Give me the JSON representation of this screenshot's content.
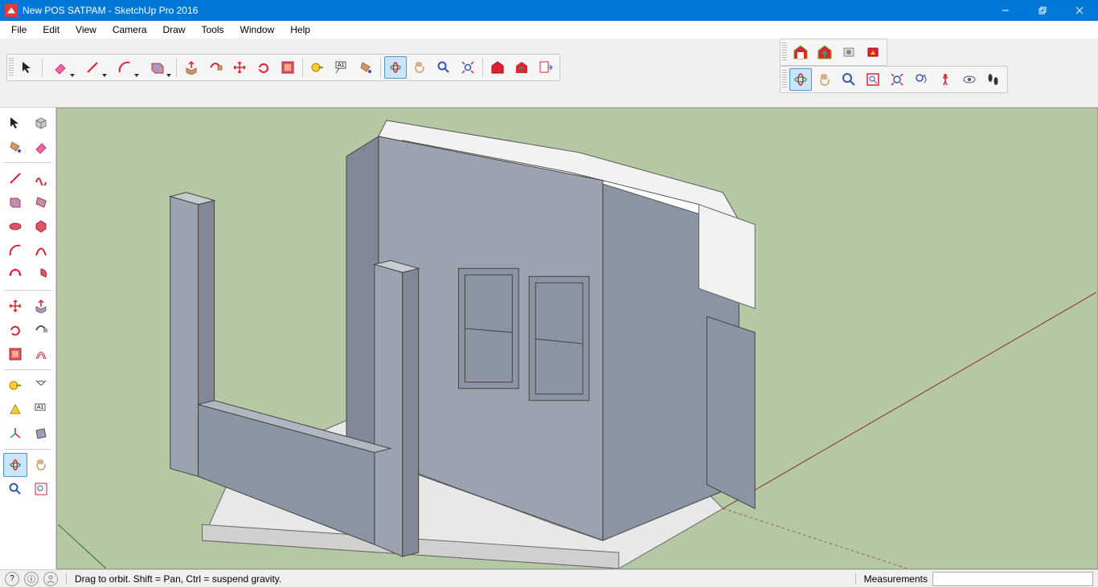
{
  "colors": {
    "accent": "#0078d7",
    "viewportGround": "#b3c8a3",
    "modelShade": "#8a94a2",
    "modelLight": "#e8e8e8"
  },
  "titlebar": {
    "title": "New POS SATPAM - SketchUp Pro 2016",
    "minimize": "Minimize",
    "maximize": "Restore Down",
    "close": "Close"
  },
  "menu": {
    "items": [
      "File",
      "Edit",
      "View",
      "Camera",
      "Draw",
      "Tools",
      "Window",
      "Help"
    ]
  },
  "topFloatA": {
    "warehouse": "3D Warehouse",
    "share": "Share Model",
    "ext1": "Extension Warehouse",
    "ext2": "Extension Manager"
  },
  "topFloatB": {
    "orbit": "Orbit",
    "pan": "Pan",
    "zoom": "Zoom",
    "zoomwin": "Zoom Window",
    "zoomext": "Zoom Extents",
    "prev": "Previous",
    "position": "Position Camera",
    "look": "Look Around",
    "walk": "Walk"
  },
  "mainToolbar": {
    "select": "Select",
    "eraser": "Eraser",
    "line": "Line",
    "arc": "Arc",
    "rect": "Rectangle",
    "pushpull": "Push/Pull",
    "followme": "Follow Me",
    "move": "Move",
    "rotate": "Rotate",
    "scale": "Offset",
    "paint": "Paint Bucket",
    "text": "Text",
    "dim": "Dimension",
    "tape": "Tape Measure",
    "orbit2": "Orbit",
    "pan2": "Pan",
    "zoom2": "Zoom",
    "zoomext2": "Zoom Extents",
    "wh": "Get Models",
    "share2": "Share Component",
    "layout": "Send to LayOut"
  },
  "largeToolset": {
    "select": "Select",
    "component": "Make Component",
    "paint": "Paint Bucket",
    "eraser": "Eraser",
    "line": "Line",
    "freehand": "Freehand",
    "rect": "Rectangle",
    "rotrect": "Rotated Rectangle",
    "circle": "Circle",
    "polygon": "Polygon",
    "arc": "Arc",
    "twoarc": "2 Point Arc",
    "arc3": "3 Point Arc",
    "pie": "Pie",
    "move": "Move",
    "pushpull": "Push/Pull",
    "rotate": "Rotate",
    "followme": "Follow Me",
    "scale": "Scale",
    "offset": "Offset",
    "tape": "Tape Measure",
    "protractor": "Protractor",
    "dim": "Dimension",
    "text": "Text",
    "axes": "Axes",
    "sectionplane": "Section Plane",
    "orbit": "Orbit",
    "pan": "Pan",
    "zoom": "Zoom",
    "zoomwin": "Zoom Window"
  },
  "statusbar": {
    "hint": "Drag to orbit. Shift = Pan, Ctrl = suspend gravity.",
    "measLabel": "Measurements",
    "measValue": "",
    "geo": "Geo-location",
    "credits": "Credits",
    "signin": "Sign In"
  }
}
